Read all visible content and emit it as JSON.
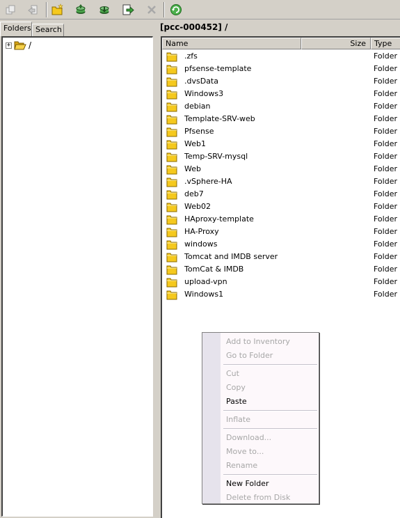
{
  "toolbar": {
    "buttons": [
      {
        "name": "copy-button",
        "icon": "copy-icon",
        "enabled": false
      },
      {
        "name": "back-button",
        "icon": "back-icon",
        "enabled": false
      },
      {
        "name": "new-folder-button",
        "icon": "new-folder-icon",
        "enabled": true
      },
      {
        "name": "upload-button",
        "icon": "upload-icon",
        "enabled": true
      },
      {
        "name": "download-button",
        "icon": "download-icon",
        "enabled": true
      },
      {
        "name": "move-button",
        "icon": "move-icon",
        "enabled": true
      },
      {
        "name": "delete-button",
        "icon": "delete-icon",
        "enabled": false
      },
      {
        "name": "refresh-button",
        "icon": "refresh-icon",
        "enabled": true
      }
    ]
  },
  "left_pane": {
    "tabs": [
      "Folders",
      "Search"
    ],
    "active_tab": "Folders",
    "tree_root": {
      "expander": "+",
      "label": "/"
    }
  },
  "right_pane": {
    "path": "[pcc-000452] /",
    "columns": {
      "name": "Name",
      "size": "Size",
      "type": "Type"
    },
    "files": [
      {
        "name": ".zfs",
        "type": "Folder"
      },
      {
        "name": "pfsense-template",
        "type": "Folder"
      },
      {
        "name": ".dvsData",
        "type": "Folder"
      },
      {
        "name": "Windows3",
        "type": "Folder"
      },
      {
        "name": "debian",
        "type": "Folder"
      },
      {
        "name": "Template-SRV-web",
        "type": "Folder"
      },
      {
        "name": "Pfsense",
        "type": "Folder"
      },
      {
        "name": "Web1",
        "type": "Folder"
      },
      {
        "name": "Temp-SRV-mysql",
        "type": "Folder"
      },
      {
        "name": "Web",
        "type": "Folder"
      },
      {
        "name": ".vSphere-HA",
        "type": "Folder"
      },
      {
        "name": "deb7",
        "type": "Folder"
      },
      {
        "name": "Web02",
        "type": "Folder"
      },
      {
        "name": "HAproxy-template",
        "type": "Folder"
      },
      {
        "name": "HA-Proxy",
        "type": "Folder"
      },
      {
        "name": "windows",
        "type": "Folder"
      },
      {
        "name": "Tomcat and IMDB server",
        "type": "Folder"
      },
      {
        "name": "TomCat & IMDB",
        "type": "Folder"
      },
      {
        "name": "upload-vpn",
        "type": "Folder"
      },
      {
        "name": "Windows1",
        "type": "Folder"
      }
    ]
  },
  "context_menu": {
    "groups": [
      [
        {
          "label": "Add to Inventory",
          "enabled": false
        },
        {
          "label": "Go to Folder",
          "enabled": false
        }
      ],
      [
        {
          "label": "Cut",
          "enabled": false
        },
        {
          "label": "Copy",
          "enabled": false
        },
        {
          "label": "Paste",
          "enabled": true
        }
      ],
      [
        {
          "label": "Inflate",
          "enabled": false
        }
      ],
      [
        {
          "label": "Download...",
          "enabled": false
        },
        {
          "label": "Move to...",
          "enabled": false
        },
        {
          "label": "Rename",
          "enabled": false
        }
      ],
      [
        {
          "label": "New Folder",
          "enabled": true
        },
        {
          "label": "Delete from Disk",
          "enabled": false
        }
      ]
    ]
  },
  "colors": {
    "window_bg": "#d4d0c8",
    "folder_yellow": "#f5c91e",
    "menu_bg": "#fdf8fb",
    "disabled_text": "#a7a7a7",
    "refresh_green": "#2e9e2e"
  }
}
